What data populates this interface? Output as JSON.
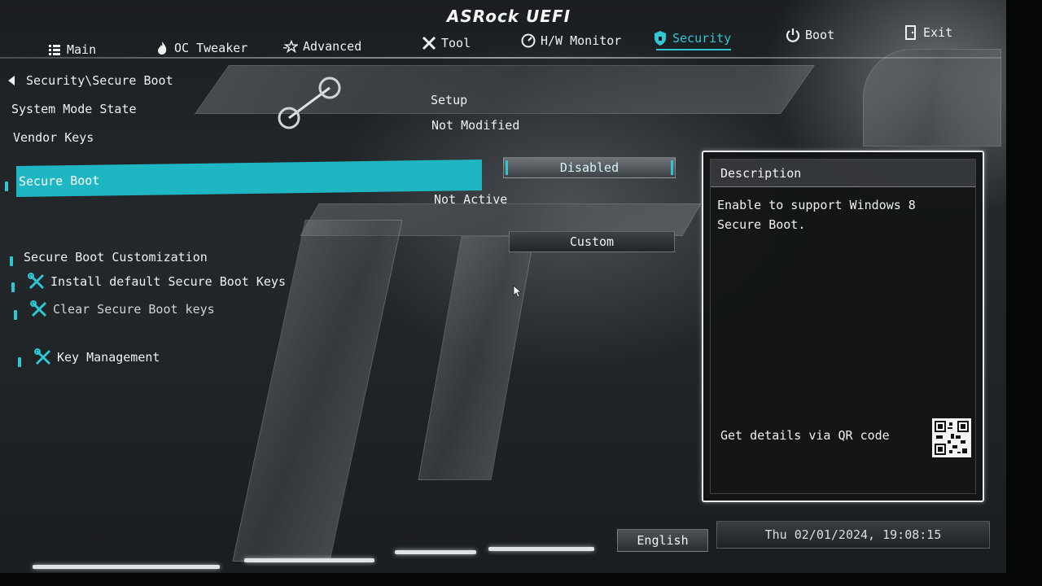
{
  "header": {
    "brand": "ASRock UEFI",
    "tabs": [
      {
        "label": "Main",
        "icon": "list-icon",
        "active": false
      },
      {
        "label": "OC Tweaker",
        "icon": "flame-icon",
        "active": false
      },
      {
        "label": "Advanced",
        "icon": "star-icon",
        "active": false
      },
      {
        "label": "Tool",
        "icon": "tools-icon",
        "active": false
      },
      {
        "label": "H/W Monitor",
        "icon": "gauge-icon",
        "active": false
      },
      {
        "label": "Security",
        "icon": "shield-icon",
        "active": true
      },
      {
        "label": "Boot",
        "icon": "power-icon",
        "active": false
      },
      {
        "label": "Exit",
        "icon": "exit-door-icon",
        "active": false
      }
    ]
  },
  "main": {
    "breadcrumb": "Security\\Secure Boot",
    "system_mode_state": {
      "label": "System Mode State",
      "value": "Setup"
    },
    "vendor_keys": {
      "label": "Vendor Keys",
      "value": "Not Modified"
    },
    "secure_boot": {
      "label": "Secure Boot",
      "value": "Disabled",
      "status": "Not Active"
    },
    "customization": {
      "label": "Secure Boot Customization",
      "value": "Custom"
    },
    "install_keys": {
      "label": "Install default Secure Boot Keys",
      "icon": "wrench-screwdriver-icon"
    },
    "clear_keys": {
      "label": "Clear Secure Boot keys",
      "icon": "wrench-screwdriver-icon"
    },
    "key_management": {
      "label": "Key Management",
      "icon": "wrench-screwdriver-icon"
    }
  },
  "description": {
    "title": "Description",
    "text": "Enable to support Windows 8 Secure Boot.",
    "qr_label": "Get details via QR code"
  },
  "footer": {
    "language": "English",
    "datetime": "Thu 02/01/2024, 19:08:15"
  },
  "colors": {
    "accent": "#1fb6c3",
    "text": "#eef1f2",
    "background": "#1b1e21"
  }
}
